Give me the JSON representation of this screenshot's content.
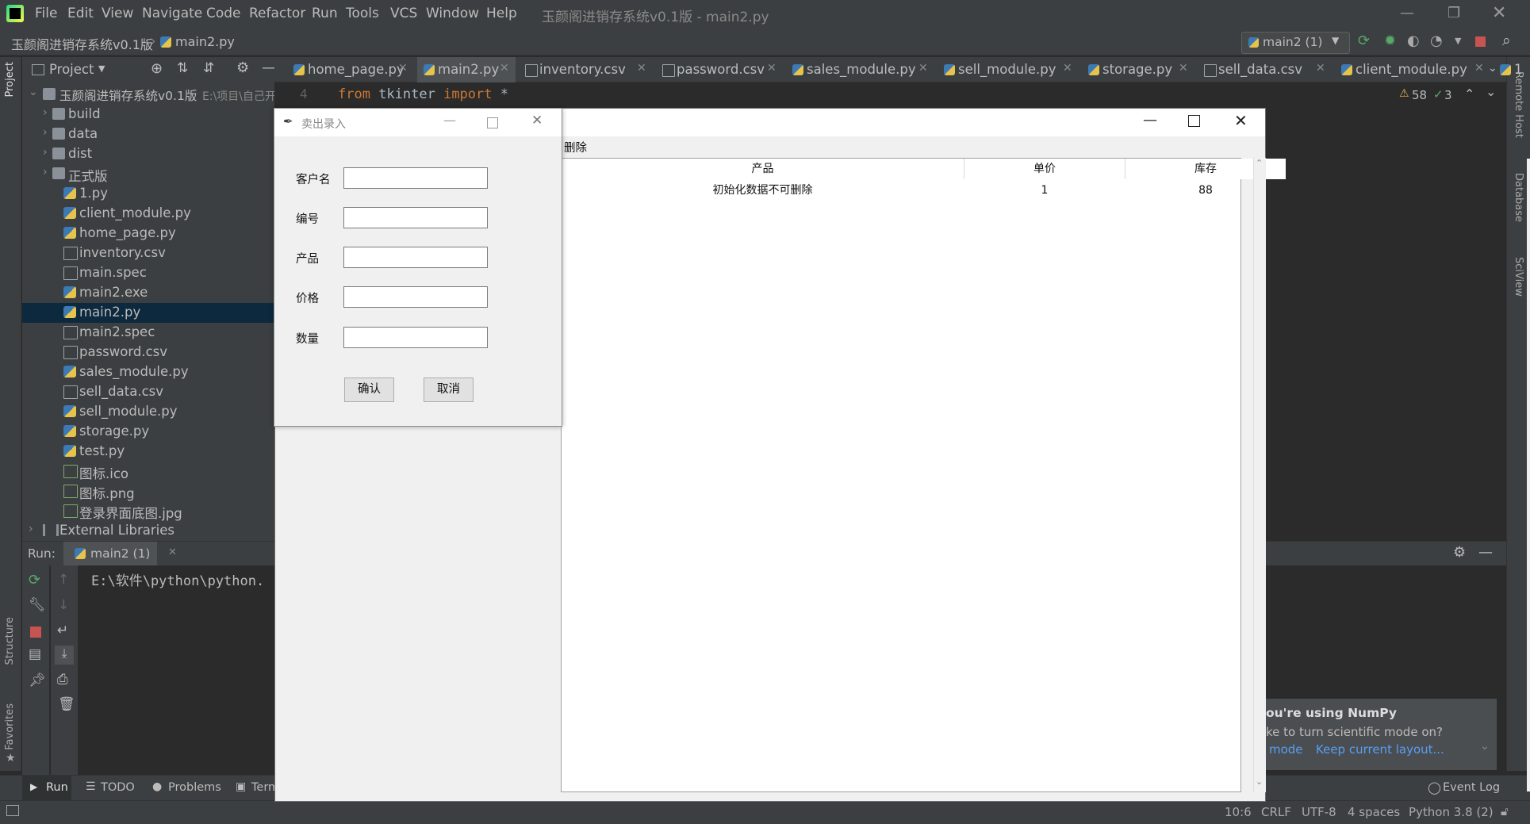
{
  "menubar": {
    "items": [
      "File",
      "Edit",
      "View",
      "Navigate",
      "Code",
      "Refactor",
      "Run",
      "Tools",
      "VCS",
      "Window",
      "Help"
    ],
    "window_title": "玉颜阁进销存系统v0.1版 - main2.py"
  },
  "navbar": {
    "project": "玉颜阁进销存系统v0.1版",
    "file": "main2.py",
    "run_config": "main2 (1)"
  },
  "project_panel": {
    "title": "Project",
    "root_name": "玉颜阁进销存系统v0.1版",
    "root_path": "E:\\项目\\自己开",
    "items": [
      {
        "label": "build",
        "type": "folder",
        "indent": 1
      },
      {
        "label": "data",
        "type": "folder",
        "indent": 1
      },
      {
        "label": "dist",
        "type": "folder",
        "indent": 1
      },
      {
        "label": "正式版",
        "type": "folder",
        "indent": 1
      },
      {
        "label": "1.py",
        "type": "py",
        "indent": 2
      },
      {
        "label": "client_module.py",
        "type": "py",
        "indent": 2
      },
      {
        "label": "home_page.py",
        "type": "py",
        "indent": 2
      },
      {
        "label": "inventory.csv",
        "type": "txt",
        "indent": 2
      },
      {
        "label": "main.spec",
        "type": "txt",
        "indent": 2
      },
      {
        "label": "main2.exe",
        "type": "py",
        "indent": 2
      },
      {
        "label": "main2.py",
        "type": "py",
        "indent": 2,
        "selected": true
      },
      {
        "label": "main2.spec",
        "type": "txt",
        "indent": 2
      },
      {
        "label": "password.csv",
        "type": "txt",
        "indent": 2
      },
      {
        "label": "sales_module.py",
        "type": "py",
        "indent": 2
      },
      {
        "label": "sell_data.csv",
        "type": "txt",
        "indent": 2
      },
      {
        "label": "sell_module.py",
        "type": "py",
        "indent": 2
      },
      {
        "label": "storage.py",
        "type": "py",
        "indent": 2
      },
      {
        "label": "test.py",
        "type": "py",
        "indent": 2
      },
      {
        "label": "图标.ico",
        "type": "img",
        "indent": 2
      },
      {
        "label": "图标.png",
        "type": "img",
        "indent": 2
      },
      {
        "label": "登录界面底图.jpg",
        "type": "img",
        "indent": 2
      }
    ],
    "external": "External Libraries"
  },
  "tabs": [
    {
      "label": "home_page.py",
      "type": "py"
    },
    {
      "label": "main2.py",
      "type": "py",
      "active": true
    },
    {
      "label": "inventory.csv",
      "type": "txt"
    },
    {
      "label": "password.csv",
      "type": "txt"
    },
    {
      "label": "sales_module.py",
      "type": "py"
    },
    {
      "label": "sell_module.py",
      "type": "py"
    },
    {
      "label": "storage.py",
      "type": "py"
    },
    {
      "label": "sell_data.csv",
      "type": "txt"
    },
    {
      "label": "client_module.py",
      "type": "py"
    },
    {
      "label": "1",
      "type": "py"
    }
  ],
  "editor": {
    "line_number": "4",
    "code_from": "from",
    "code_module": " tkinter ",
    "code_import": "import",
    "code_star": " *",
    "warnings": "58",
    "checks": "3"
  },
  "run_panel": {
    "label": "Run:",
    "tab": "main2 (1)",
    "output": "E:\\软件\\python\\python."
  },
  "bottom_bar": {
    "run": "Run",
    "todo": "TODO",
    "problems": "Problems",
    "terminal": "Term",
    "event_log": "Event Log"
  },
  "status_bar": {
    "position": "10:6",
    "line_sep": "CRLF",
    "encoding": "UTF-8",
    "indent": "4 spaces",
    "interpreter": "Python 3.8 (2)"
  },
  "side_labels": {
    "project": "Project",
    "structure": "Structure",
    "favorites": "Favorites",
    "remote_host": "Remote Host",
    "database": "Database",
    "sciview": "SciView"
  },
  "notification": {
    "title": "ou're using NumPy",
    "body": "ke to turn scientific mode on?",
    "link1": "mode",
    "link2": "Keep current layout..."
  },
  "tk_main": {
    "toolbar_text": "删除",
    "columns": [
      "产品",
      "单价",
      "库存"
    ],
    "row": [
      "初始化数据不可删除",
      "1",
      "88"
    ]
  },
  "dialog": {
    "title": "卖出录入",
    "fields": [
      {
        "label": "客户名",
        "value": ""
      },
      {
        "label": "编号",
        "value": ""
      },
      {
        "label": "产品",
        "value": ""
      },
      {
        "label": "价格",
        "value": ""
      },
      {
        "label": "数量",
        "value": ""
      }
    ],
    "confirm": "确认",
    "cancel": "取消"
  }
}
